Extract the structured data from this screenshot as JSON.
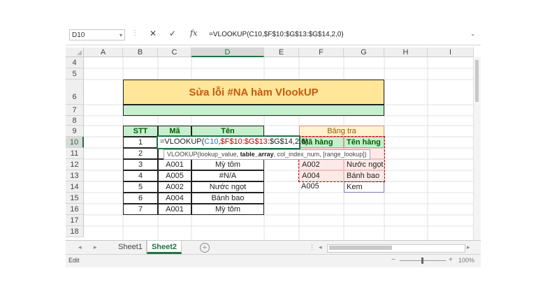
{
  "formula_bar": {
    "name_box": "D10",
    "name_box_dropdown": "▾",
    "dots": "⋮",
    "cancel_icon": "✕",
    "enter_icon": "✓",
    "fx_label": "fx",
    "formula": "=VLOOKUP(C10,$F$10:$G$13:$G$14,2,0)",
    "expand_icon": "⌄"
  },
  "columns": [
    "A",
    "B",
    "C",
    "D",
    "E",
    "F",
    "G",
    "H",
    "I"
  ],
  "selected_column": "D",
  "rows": [
    "4",
    "5",
    "6",
    "7",
    "8",
    "9",
    "10",
    "11",
    "12",
    "13",
    "14",
    "15",
    "16",
    "17",
    "18"
  ],
  "selected_row": "10",
  "sheet": {
    "title": "Sửa lỗi #NA hàm VlookUP",
    "table_headers": {
      "stt": "STT",
      "ma": "Mã",
      "ten": "Tên"
    },
    "table_rows": [
      {
        "stt": "1",
        "ma": "",
        "ten": ""
      },
      {
        "stt": "2",
        "ma": "",
        "ten": ""
      },
      {
        "stt": "3",
        "ma": "A001",
        "ten": "Mỳ tôm"
      },
      {
        "stt": "4",
        "ma": "A005",
        "ten": "#N/A"
      },
      {
        "stt": "5",
        "ma": "A002",
        "ten": "Nước ngọt"
      },
      {
        "stt": "6",
        "ma": "A004",
        "ten": "Bánh bao"
      },
      {
        "stt": "7",
        "ma": "A001",
        "ten": "Mỳ tôm"
      }
    ],
    "lookup_title": "Bảng tra",
    "lookup_headers": {
      "ma_hang": "Mã hàng",
      "ten_hang": "Tên hàng"
    },
    "lookup_rows": [
      {
        "ma": "",
        "ten": ""
      },
      {
        "ma": "A002",
        "ten": "Nước ngọt"
      },
      {
        "ma": "A004",
        "ten": "Bánh bao"
      },
      {
        "ma": "A005",
        "ten": "Kem"
      }
    ],
    "edit_cell": {
      "p1": "=VLOOKUP(",
      "p2": "C10",
      "p3": ",",
      "p4": "$F$10:$G$13",
      "p5": ":$G$14,2,0)"
    },
    "tooltip": {
      "t1": "VLOOKUP(lookup_value, ",
      "t2": "table_array",
      "t3": ", col_index_num, [range_lookup])"
    }
  },
  "tabs": {
    "nav_prev": "◂",
    "nav_next": "▸",
    "sheet1": "Sheet1",
    "sheet2": "Sheet2",
    "add": "+",
    "ellipsis": "⋮",
    "scroll_left": "◂",
    "scroll_right": "▸"
  },
  "status": {
    "mode": "Edit",
    "zoom_minus": "−",
    "zoom_plus": "+",
    "zoom": "100%"
  },
  "colors": {
    "excel_green": "#217346",
    "title_fill": "#ffe699",
    "header_fill": "#c6efce",
    "lookup_pink": "#fde9e7"
  }
}
